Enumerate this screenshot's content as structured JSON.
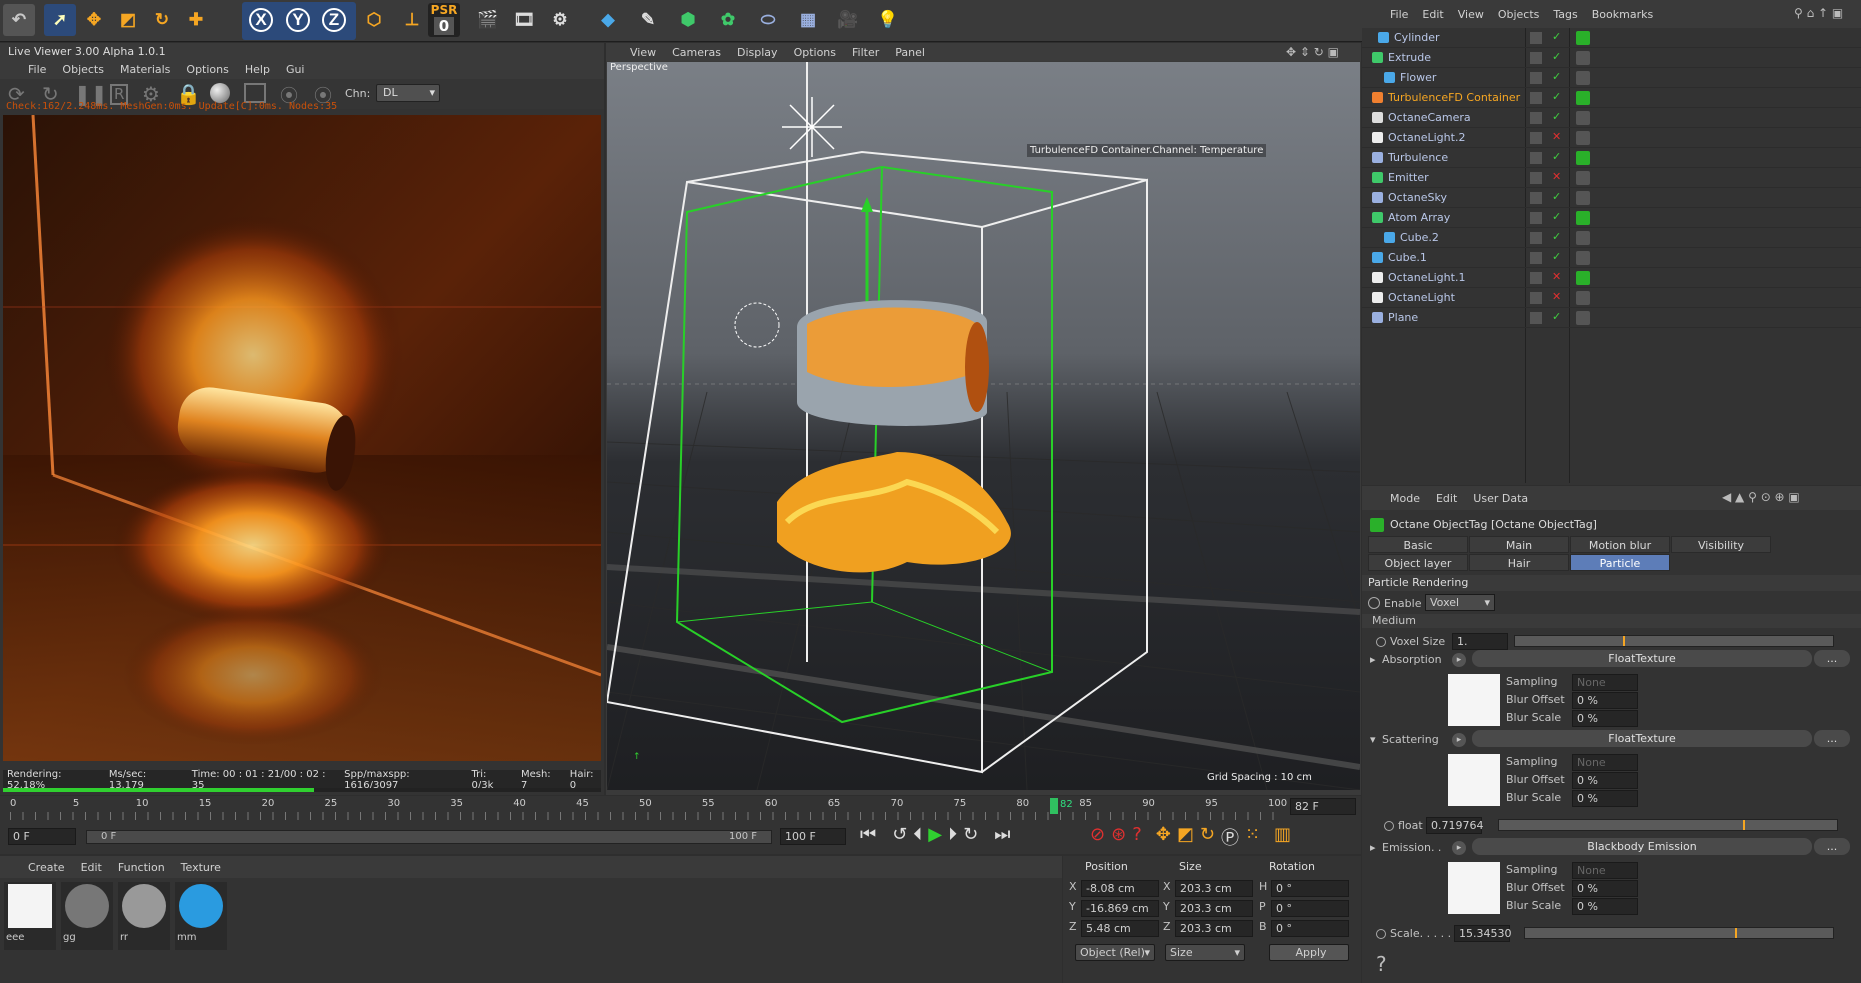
{
  "toolbar": {
    "psr_label": "PSR",
    "psr_value": "0",
    "x": "X",
    "y": "Y",
    "z": "Z"
  },
  "live_viewer": {
    "title": "Live Viewer 3.00 Alpha 1.0.1",
    "menu": [
      "File",
      "Objects",
      "Materials",
      "Options",
      "Help",
      "Gui"
    ],
    "chn_label": "Chn:",
    "chn_value": "DL",
    "status_top": "Check:162/2.248ms. MeshGen:0ms. Update[C]:0ms. Nodes:35",
    "status": {
      "rendering": "Rendering: 52.18%",
      "mssec": "Ms/sec: 13.179",
      "time": "Time: 00 : 01 : 21/00 : 02 : 35",
      "spp": "Spp/maxspp: 1616/3097",
      "tri": "Tri: 0/3k",
      "mesh": "Mesh: 7",
      "hair": "Hair: 0"
    },
    "progress": 0.52
  },
  "viewport": {
    "menu": [
      "View",
      "Cameras",
      "Display",
      "Options",
      "Filter",
      "Panel"
    ],
    "label": "Perspective",
    "channel_label": "TurbulenceFD Container.Channel: Temperature",
    "grid_spacing": "Grid Spacing : 10 cm"
  },
  "object_manager": {
    "menu": [
      "File",
      "Edit",
      "View",
      "Objects",
      "Tags",
      "Bookmarks"
    ],
    "objects": [
      {
        "name": "Cylinder",
        "indent": 1
      },
      {
        "name": "Extrude",
        "indent": 0
      },
      {
        "name": "Flower",
        "indent": 2
      },
      {
        "name": "TurbulenceFD Container",
        "indent": 0,
        "highlight": true
      },
      {
        "name": "OctaneCamera",
        "indent": 0
      },
      {
        "name": "OctaneLight.2",
        "indent": 0
      },
      {
        "name": "Turbulence",
        "indent": 0
      },
      {
        "name": "Emitter",
        "indent": 0
      },
      {
        "name": "OctaneSky",
        "indent": 0
      },
      {
        "name": "Atom Array",
        "indent": 0
      },
      {
        "name": "Cube.2",
        "indent": 2
      },
      {
        "name": "Cube.1",
        "indent": 0
      },
      {
        "name": "OctaneLight.1",
        "indent": 0
      },
      {
        "name": "OctaneLight",
        "indent": 0
      },
      {
        "name": "Plane",
        "indent": 0
      }
    ]
  },
  "attributes": {
    "menu": [
      "Mode",
      "Edit",
      "User Data"
    ],
    "tag_title": "Octane ObjectTag [Octane ObjectTag]",
    "tabs_row1": [
      "Basic",
      "Main",
      "Motion blur",
      "Visibility"
    ],
    "tabs_row2": [
      "Object layer",
      "Hair",
      "Particle Rendering"
    ],
    "section": "Particle Rendering",
    "enable_label": "Enable",
    "enable_value": "Voxel",
    "medium_label": "Medium",
    "voxel_size_label": "Voxel Size",
    "voxel_size_value": "1.",
    "absorption_label": "Absorption",
    "absorption_btn": "FloatTexture",
    "scattering_label": "Scattering",
    "scattering_btn": "FloatTexture",
    "emission_label": "Emission. .",
    "emission_btn": "Blackbody Emission",
    "sampling_label": "Sampling",
    "sampling_value": "None",
    "blur_offset_label": "Blur Offset",
    "blur_offset_value": "0 %",
    "blur_scale_label": "Blur Scale",
    "blur_scale_value": "0 %",
    "float_label": "float",
    "float_value": "0.719764",
    "scale_label": "Scale. . . . .",
    "scale_value": "15.34530",
    "more_btn": "..."
  },
  "timeline": {
    "ticks": [
      "0",
      "5",
      "10",
      "15",
      "20",
      "25",
      "30",
      "35",
      "40",
      "45",
      "50",
      "55",
      "60",
      "65",
      "70",
      "75",
      "80",
      "85",
      "90",
      "95",
      "100"
    ],
    "current_marker": "82",
    "current_field": "82 F",
    "start_field": "0 F",
    "range_start": "0 F",
    "range_end": "100 F",
    "end_field": "100 F"
  },
  "materials": {
    "menu": [
      "Create",
      "Edit",
      "Function",
      "Texture"
    ],
    "items": [
      {
        "name": "eee",
        "color": "#f4f4f4"
      },
      {
        "name": "gg",
        "color": "#777777"
      },
      {
        "name": "rr",
        "color": "#999999"
      },
      {
        "name": "mm",
        "color": "#2a9be0"
      }
    ]
  },
  "coordinates": {
    "headers": [
      "Position",
      "Size",
      "Rotation"
    ],
    "rows": [
      {
        "axis": "X",
        "pos": "-8.08 cm",
        "size_axis": "X",
        "size": "203.3 cm",
        "rot_axis": "H",
        "rot": "0 °"
      },
      {
        "axis": "Y",
        "pos": "-16.869 cm",
        "size_axis": "Y",
        "size": "203.3 cm",
        "rot_axis": "P",
        "rot": "0 °"
      },
      {
        "axis": "Z",
        "pos": "5.48 cm",
        "size_axis": "Z",
        "size": "203.3 cm",
        "rot_axis": "B",
        "rot": "0 °"
      }
    ],
    "mode1": "Object (Rel)",
    "mode2": "Size",
    "apply": "Apply"
  }
}
